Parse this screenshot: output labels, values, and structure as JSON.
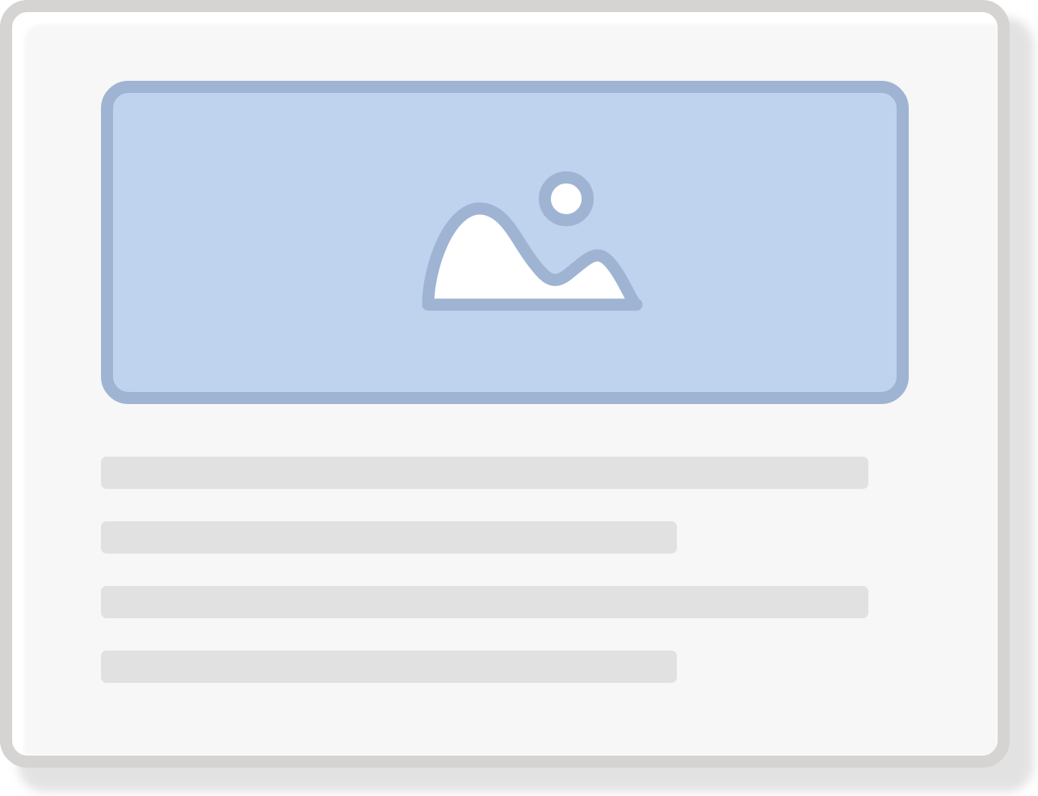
{
  "colors": {
    "frame_border": "#d5d4d2",
    "frame_fill": "#f7f7f7",
    "image_fill": "#bfd3ef",
    "image_border": "#9fb4d3",
    "skeleton_line": "#e1e1e1",
    "icon_fill": "#ffffff"
  },
  "placeholder": {
    "icon": "image-placeholder-icon"
  },
  "skeleton_lines": [
    {
      "length_fraction": 0.95
    },
    {
      "length_fraction": 0.713
    },
    {
      "length_fraction": 0.95
    },
    {
      "length_fraction": 0.713
    }
  ]
}
